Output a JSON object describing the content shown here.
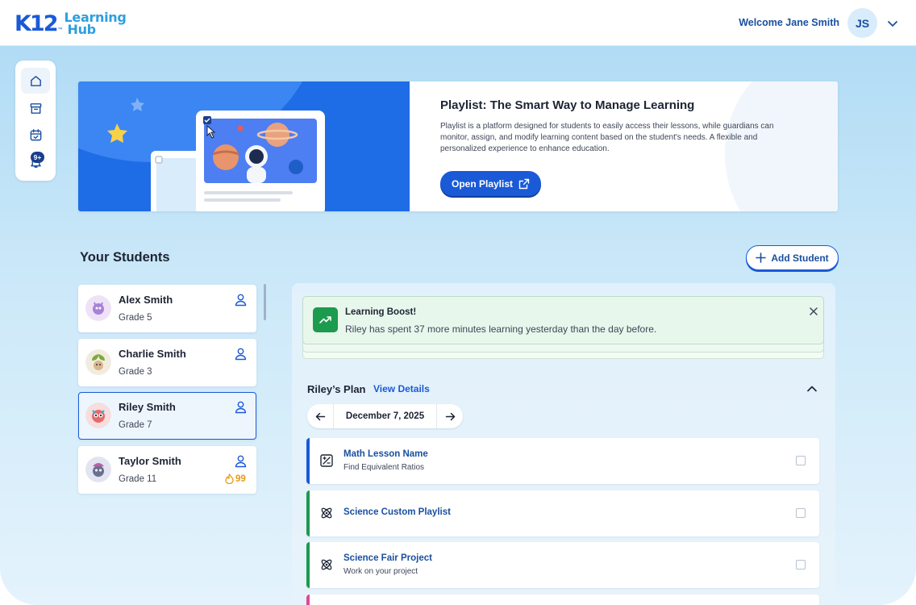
{
  "header": {
    "logo_mark": "K12",
    "logo_tm": "™",
    "logo_word1": "Learning",
    "logo_word2": "Hub",
    "welcome": "Welcome Jane Smith",
    "avatar_initials": "JS"
  },
  "rail": {
    "items": [
      {
        "name": "home-icon",
        "active": true
      },
      {
        "name": "archive-icon",
        "active": false
      },
      {
        "name": "calendar-icon",
        "active": false
      },
      {
        "name": "bell-icon",
        "active": false
      }
    ],
    "notification_badge": "9+"
  },
  "banner": {
    "title": "Playlist: The Smart Way to Manage Learning",
    "description": "Playlist is a platform designed for students to easily access their lessons, while guardians can monitor, assign, and modify learning content based on the student's needs. A flexible and personalized experience to enhance education.",
    "button_label": "Open Playlist"
  },
  "students": {
    "title": "Your Students",
    "add_button": "Add Student",
    "list": [
      {
        "name": "Alex Smith",
        "grade": "Grade 5",
        "selected": false,
        "streak": ""
      },
      {
        "name": "Charlie Smith",
        "grade": "Grade 3",
        "selected": false,
        "streak": ""
      },
      {
        "name": "Riley Smith",
        "grade": "Grade 7",
        "selected": true,
        "streak": ""
      },
      {
        "name": "Taylor Smith",
        "grade": "Grade 11",
        "selected": false,
        "streak": "99"
      }
    ]
  },
  "boost": {
    "title": "Learning Boost!",
    "text": "Riley has spent 37 more minutes learning yesterday than the day before."
  },
  "plan": {
    "title": "Riley’s Plan",
    "view_details": "View Details",
    "date": "December 7, 2025",
    "lessons": [
      {
        "name": "Math Lesson Name",
        "subtitle": "Find Equivalent Ratios",
        "accent": "#1a5ad7",
        "icon": "math-icon"
      },
      {
        "name": "Science Custom Playlist",
        "subtitle": "",
        "accent": "#1c9a4e",
        "icon": "atom-icon"
      },
      {
        "name": "Science Fair Project",
        "subtitle": "Work on your project",
        "accent": "#1c9a4e",
        "icon": "atom-icon"
      }
    ]
  },
  "colors": {
    "primary": "#1a5ad7",
    "success": "#1c9a4e",
    "streak": "#e59a15",
    "background": "#b1dcf5"
  }
}
